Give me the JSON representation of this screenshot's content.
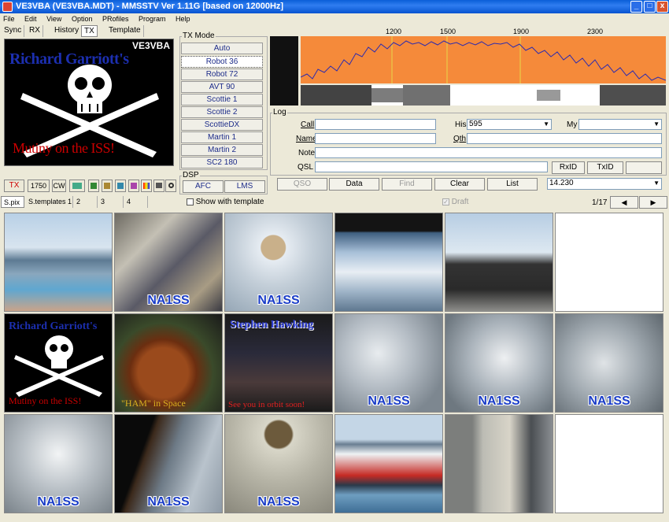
{
  "window": {
    "title": "VE3VBA (VE3VBA.MDT) - MMSSTV Ver 1.11G [based on 12000Hz]",
    "controls": [
      "_",
      "□",
      "x"
    ]
  },
  "menu": [
    "File",
    "Edit",
    "View",
    "Option",
    "PRofiles",
    "Program",
    "Help"
  ],
  "top_tabs": [
    "Sync",
    "RX",
    "History",
    "TX",
    "Template"
  ],
  "top_tab_active": "TX",
  "main_image": {
    "callsign": "VE3VBA",
    "top_text": "Richard Garriott's",
    "bottom_text": "Mutiny on the ISS!"
  },
  "tx_toolbar": {
    "tx_label": "TX",
    "tone": "1750",
    "cw": "CW"
  },
  "tx_mode": {
    "label": "TX Mode",
    "modes": [
      "Auto",
      "Robot 36",
      "Robot 72",
      "AVT 90",
      "Scottie 1",
      "Scottie 2",
      "ScottieDX",
      "Martin 1",
      "Martin 2",
      "SC2 180"
    ],
    "selected": "Robot 36"
  },
  "dsp": {
    "label": "DSP",
    "afc": "AFC",
    "lms": "LMS"
  },
  "show_with_template": "Show with template",
  "spectrum": {
    "freq_labels": [
      "1200",
      "1500",
      "1900",
      "2300"
    ],
    "colors": {
      "background": "#f58a3a",
      "trace": "#2b2bb0",
      "marker": "#e8d84a"
    }
  },
  "log": {
    "label": "Log",
    "call_label": "Call",
    "call_value": "",
    "his_label": "His",
    "his_value": "595",
    "my_label": "My",
    "my_value": "",
    "name_label": "Name",
    "qth_label": "Qth",
    "note_label": "Note",
    "qsl_label": "QSL",
    "rxid": "RxID",
    "txid": "TxID",
    "extra_btn": "",
    "qso": "QSO",
    "data": "Data",
    "find": "Find",
    "clear": "Clear",
    "list": "List",
    "freq": "14.230"
  },
  "draft_label": "Draft",
  "page_indicator": "1/17",
  "stock_tabs": [
    "S.pix",
    "S.templates 1",
    "2",
    "3",
    "4"
  ],
  "thumbnails": [
    {
      "label": "",
      "desc": "bridge"
    },
    {
      "label": "NA1SS",
      "desc": "iss-interior"
    },
    {
      "label": "NA1SS",
      "desc": "spacecraft"
    },
    {
      "label": "",
      "desc": "earth"
    },
    {
      "label": "",
      "desc": "ship"
    },
    {
      "label": "",
      "desc": "blank"
    },
    {
      "label": "",
      "desc": "pirate",
      "top": "Richard Garriott's",
      "bottom": "Mutiny on the ISS!"
    },
    {
      "label": "",
      "desc": "ham",
      "bottom": "\"HAM\" in Space"
    },
    {
      "label": "",
      "desc": "group",
      "top": "Stephen Hawking",
      "bottom": "See you in orbit soon!"
    },
    {
      "label": "NA1SS",
      "desc": "clouds"
    },
    {
      "label": "NA1SS",
      "desc": "clouds"
    },
    {
      "label": "NA1SS",
      "desc": "clouds"
    },
    {
      "label": "NA1SS",
      "desc": "clouds"
    },
    {
      "label": "NA1SS",
      "desc": "earth-dark"
    },
    {
      "label": "NA1SS",
      "desc": "spacecraft2"
    },
    {
      "label": "",
      "desc": "fireboat"
    },
    {
      "label": "",
      "desc": "operator"
    },
    {
      "label": "",
      "desc": "blank"
    }
  ]
}
